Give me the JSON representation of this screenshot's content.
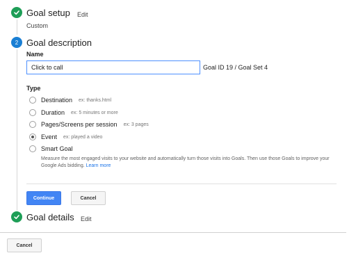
{
  "goal_setup": {
    "title": "Goal setup",
    "edit": "Edit",
    "subtitle": "Custom",
    "icon": "check-circle-icon"
  },
  "goal_description": {
    "step_number": "2",
    "title": "Goal description",
    "name_label": "Name",
    "name_value": "Click to call",
    "goal_id_text": "Goal ID 19 / Goal Set 4",
    "type_label": "Type",
    "types": [
      {
        "label": "Destination",
        "example": "ex: thanks.html",
        "selected": false
      },
      {
        "label": "Duration",
        "example": "ex: 5 minutes or more",
        "selected": false
      },
      {
        "label": "Pages/Screens per session",
        "example": "ex: 3 pages",
        "selected": false
      },
      {
        "label": "Event",
        "example": "ex: played a video",
        "selected": true
      },
      {
        "label": "Smart Goal",
        "example": "",
        "selected": false
      }
    ],
    "smart_goal_description": "Measure the most engaged visits to your website and automatically turn those visits into Goals. Then use those Goals to improve your Google Ads bidding.",
    "learn_more": "Learn more",
    "continue_label": "Continue",
    "cancel_label": "Cancel"
  },
  "goal_details": {
    "title": "Goal details",
    "edit": "Edit",
    "icon": "check-circle-icon"
  },
  "footer": {
    "cancel_label": "Cancel"
  },
  "colors": {
    "done_green": "#1e9e57",
    "step_blue": "#1a7fd4",
    "primary_button": "#4285f4",
    "link": "#1a73e8"
  }
}
